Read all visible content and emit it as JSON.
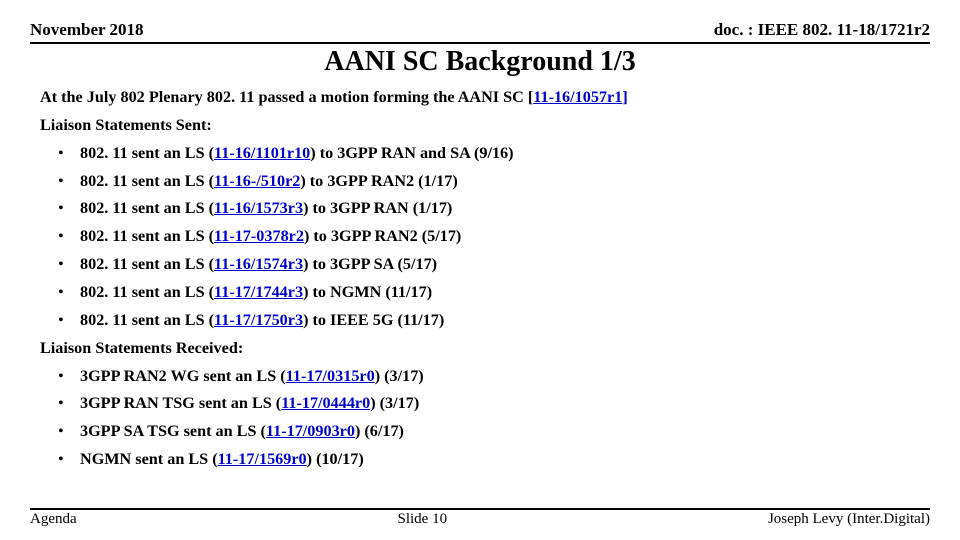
{
  "header": {
    "left": "November 2018",
    "right": "doc. : IEEE 802. 11-18/1721r2"
  },
  "title": "AANI SC Background 1/3",
  "intro": {
    "prefix": "At the July 802 Plenary 802. 11 passed a motion forming the AANI SC [",
    "link": "11-16/1057r1",
    "suffix": "]"
  },
  "sent_heading": "Liaison Statements Sent:",
  "sent": [
    {
      "pre": "802. 11 sent an LS (",
      "link": "11-16/1101r10",
      "post": ") to 3GPP RAN and SA (9/16)"
    },
    {
      "pre": "802. 11 sent an LS (",
      "link": "11-16-/510r2",
      "post": ") to 3GPP RAN2 (1/17)"
    },
    {
      "pre": "802. 11 sent an LS (",
      "link": "11-16/1573r3",
      "post": ") to 3GPP RAN (1/17)"
    },
    {
      "pre": "802. 11 sent an LS (",
      "link": "11-17-0378r2",
      "post": ") to 3GPP RAN2 (5/17)"
    },
    {
      "pre": "802. 11 sent an LS (",
      "link": "11-16/1574r3",
      "post": ") to 3GPP SA (5/17)"
    },
    {
      "pre": "802. 11 sent an LS (",
      "link": "11-17/1744r3",
      "post": ") to NGMN (11/17)"
    },
    {
      "pre": "802. 11 sent an LS (",
      "link": "11-17/1750r3",
      "post": ") to IEEE 5G (11/17)"
    }
  ],
  "recv_heading": "Liaison Statements Received:",
  "recv": [
    {
      "pre": "3GPP RAN2 WG sent an LS (",
      "link": "11-17/0315r0",
      "post": ") (3/17)"
    },
    {
      "pre": "3GPP RAN TSG sent an LS (",
      "link": "11-17/0444r0",
      "post": ") (3/17)"
    },
    {
      "pre": "3GPP SA TSG sent an LS (",
      "link": "11-17/0903r0",
      "post": ") (6/17)"
    },
    {
      "pre": "NGMN sent an LS (",
      "link": "11-17/1569r0",
      "post": ") (10/17)"
    }
  ],
  "footer": {
    "left": "Agenda",
    "center": "Slide 10",
    "right": "Joseph Levy (Inter.Digital)"
  }
}
